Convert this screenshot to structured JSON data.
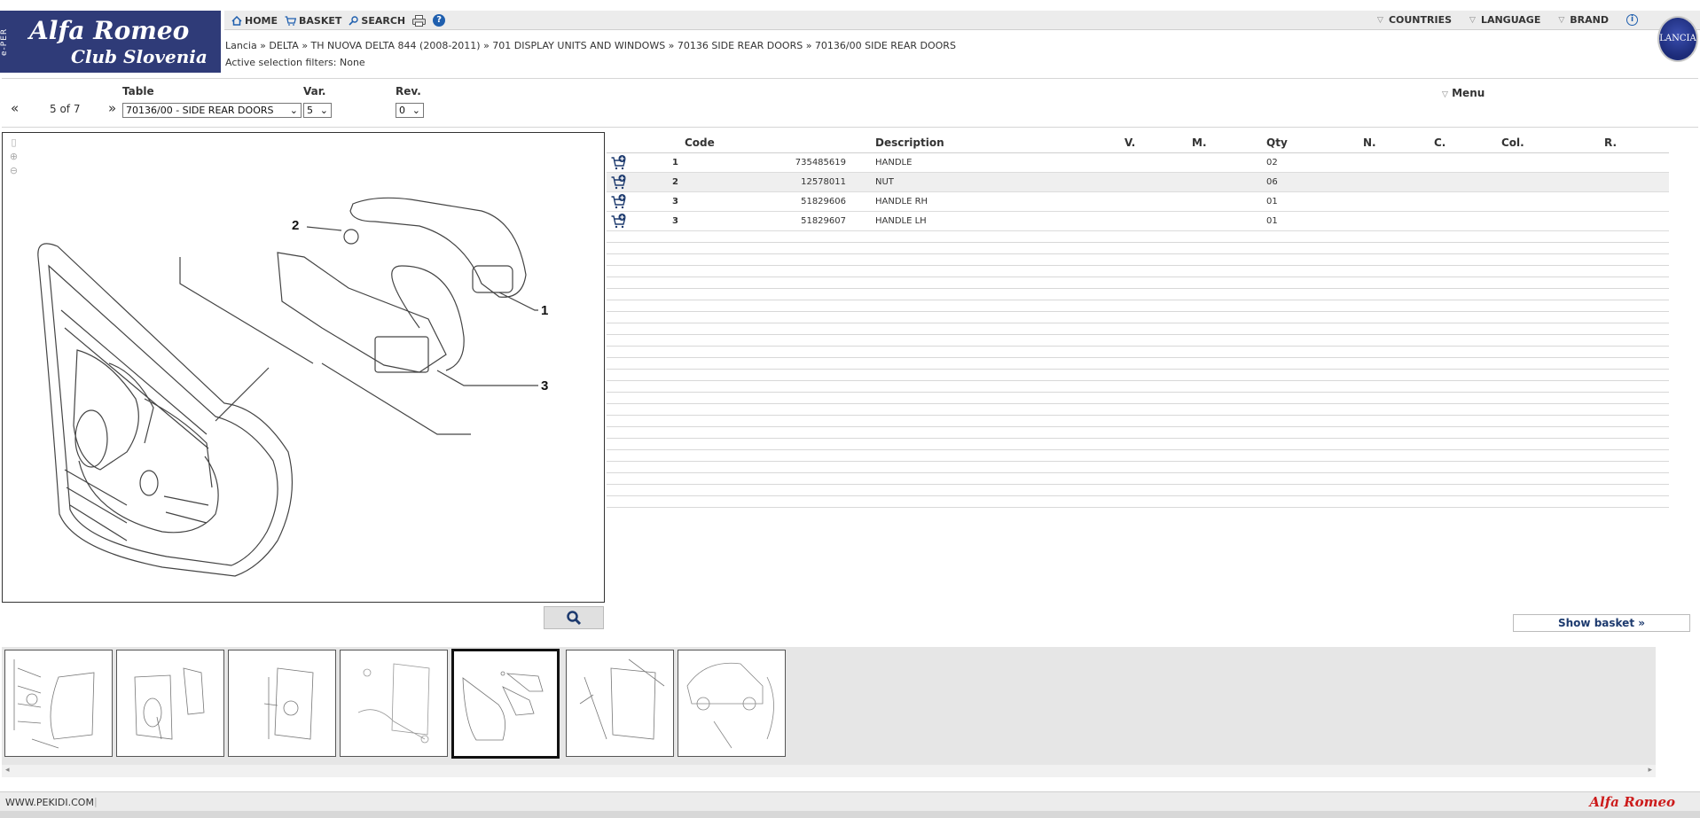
{
  "header": {
    "logo_strip": "e-PER",
    "logo_line1": "Alfa Romeo",
    "logo_line2": "Club Slovenia",
    "nav": {
      "home": "HOME",
      "basket": "BASKET",
      "search": "SEARCH"
    },
    "nav_right": {
      "countries": "COUNTRIES",
      "language": "LANGUAGE",
      "brand": "BRAND"
    },
    "breadcrumb": "Lancia » DELTA » TH NUOVA DELTA 844 (2008-2011) » 701 DISPLAY UNITS AND WINDOWS » 70136 SIDE REAR DOORS » 70136/00 SIDE REAR DOORS",
    "filters": "Active selection filters: None",
    "brand_logo_text": "LANCIA"
  },
  "selection": {
    "table_label": "Table",
    "var_label": "Var.",
    "rev_label": "Rev.",
    "prev": "«",
    "next": "»",
    "position": "5 of 7",
    "table_value": "70136/00 - SIDE REAR DOORS",
    "var_value": "5",
    "rev_value": "0",
    "menu": "Menu"
  },
  "drawing": {
    "callouts": [
      "1",
      "2",
      "3"
    ]
  },
  "parts": {
    "columns": {
      "code": "Code",
      "description": "Description",
      "v": "V.",
      "m": "M.",
      "qty": "Qty",
      "n": "N.",
      "c": "C.",
      "col": "Col.",
      "r": "R."
    },
    "rows": [
      {
        "ref": "1",
        "code": "735485619",
        "description": "HANDLE",
        "qty": "02"
      },
      {
        "ref": "2",
        "code": "12578011",
        "description": "NUT",
        "qty": "06"
      },
      {
        "ref": "3",
        "code": "51829606",
        "description": "HANDLE RH",
        "qty": "01"
      },
      {
        "ref": "3",
        "code": "51829607",
        "description": "HANDLE LH",
        "qty": "01"
      }
    ]
  },
  "show_basket": "Show basket »",
  "footer": {
    "site": "WWW.PEKIDI.COM",
    "brand": "Alfa Romeo"
  },
  "colors": {
    "header_blue": "#2f3b78",
    "accent_red": "#cc1b1b",
    "link_blue": "#1d3a6e"
  }
}
